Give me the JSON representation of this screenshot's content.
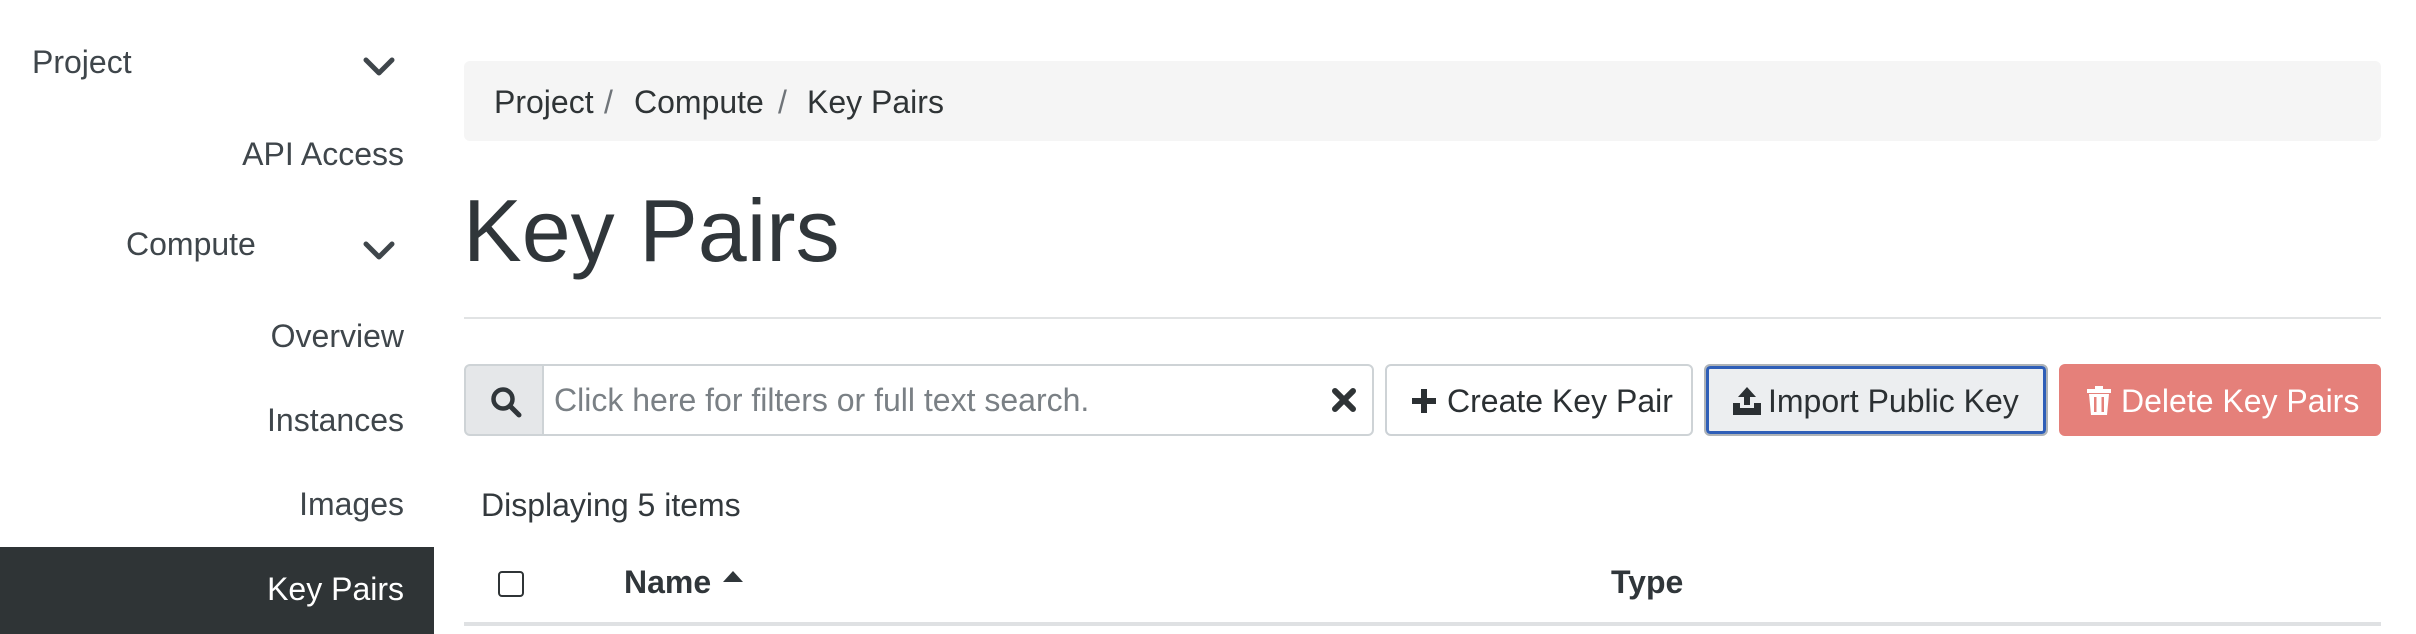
{
  "sidebar": {
    "project_label": "Project",
    "api_access_label": "API Access",
    "compute_label": "Compute",
    "overview_label": "Overview",
    "instances_label": "Instances",
    "images_label": "Images",
    "key_pairs_label": "Key Pairs",
    "active_item": "Key Pairs"
  },
  "breadcrumb": {
    "items": [
      "Project",
      "Compute",
      "Key Pairs"
    ],
    "separator": "/"
  },
  "page": {
    "title": "Key Pairs"
  },
  "toolbar": {
    "search_placeholder": "Click here for filters or full text search.",
    "search_value": "",
    "create_label": "Create Key Pair",
    "import_label": "Import Public Key",
    "delete_label": "Delete Key Pairs"
  },
  "table": {
    "count_text": "Displaying 5 items",
    "columns": [
      "Name",
      "Type"
    ],
    "sort_column": "Name",
    "sort_direction": "ascending"
  },
  "icons": {
    "collapse": "chevron-down-icon",
    "search": "search-icon",
    "clear": "close-icon",
    "create": "plus-icon",
    "import": "upload-icon",
    "delete": "trash-icon",
    "sort": "caret-up-icon"
  },
  "colors": {
    "sidebar_active_bg": "#2f3436",
    "delete_button_bg": "#e5807a",
    "focus_ring": "#2f5fb8",
    "breadcrumb_bg": "#f5f5f5"
  }
}
